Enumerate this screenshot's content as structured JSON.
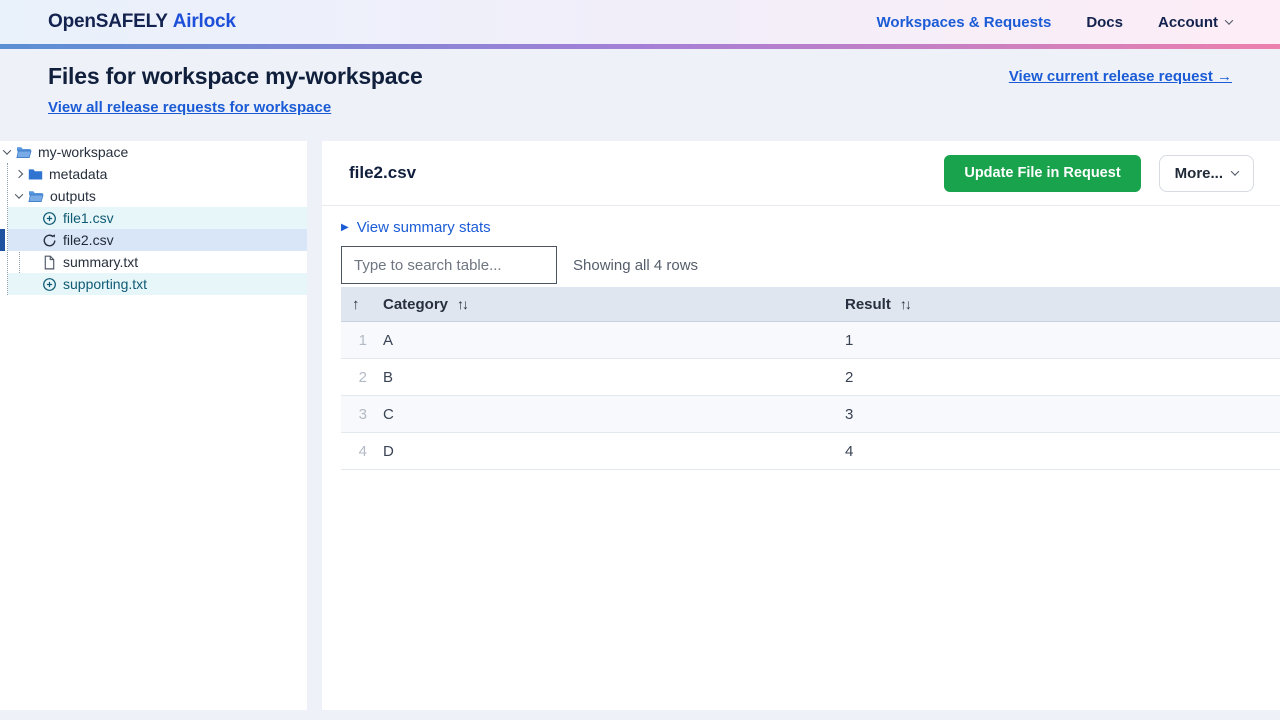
{
  "navbar": {
    "brand_primary": "OpenSAFELY",
    "brand_secondary": "Airlock",
    "links": [
      {
        "label": "Workspaces & Requests"
      },
      {
        "label": "Docs"
      },
      {
        "label": "Account"
      }
    ]
  },
  "header": {
    "title": "Files for workspace my-workspace",
    "current_request_link": "View current release request →",
    "all_requests_link": "View all release requests for workspace"
  },
  "sidebar": {
    "root": {
      "label": "my-workspace"
    },
    "folders": [
      {
        "label": "metadata"
      },
      {
        "label": "outputs"
      }
    ],
    "files": [
      {
        "label": "file1.csv",
        "icon": "circle-plus-icon",
        "state": "added"
      },
      {
        "label": "file2.csv",
        "icon": "restore-icon",
        "state": "selected"
      },
      {
        "label": "summary.txt",
        "icon": "document-icon",
        "state": "default"
      },
      {
        "label": "supporting.txt",
        "icon": "circle-plus-icon",
        "state": "added"
      }
    ]
  },
  "main": {
    "file_title": "file2.csv",
    "update_button": "Update File in Request",
    "more_button": "More...",
    "summary_toggle": "View summary stats",
    "search_placeholder": "Type to search table...",
    "rows_status": "Showing all 4 rows"
  },
  "icons": {
    "sort_asc": "↑",
    "sort_both": "↑↓",
    "toggle_triangle": "▶"
  },
  "table": {
    "columns": [
      {
        "label": "Category"
      },
      {
        "label": "Result"
      }
    ],
    "rows": [
      {
        "n": "1",
        "category": "A",
        "result": "1"
      },
      {
        "n": "2",
        "category": "B",
        "result": "2"
      },
      {
        "n": "3",
        "category": "C",
        "result": "3"
      },
      {
        "n": "4",
        "category": "D",
        "result": "4"
      }
    ]
  },
  "colors": {
    "brand_navy": "#13224e",
    "link_blue": "#1b5cd6",
    "button_green": "#18a34c",
    "selected_row_blue": "#d8e6f7",
    "added_row_cyan": "#e7f6f9",
    "selection_bar_blue": "#1e50a0",
    "table_header_bg": "#e0e6ef",
    "gradient_bar": "#5a8fd4 → #a57fd6 → #ec80ae"
  }
}
